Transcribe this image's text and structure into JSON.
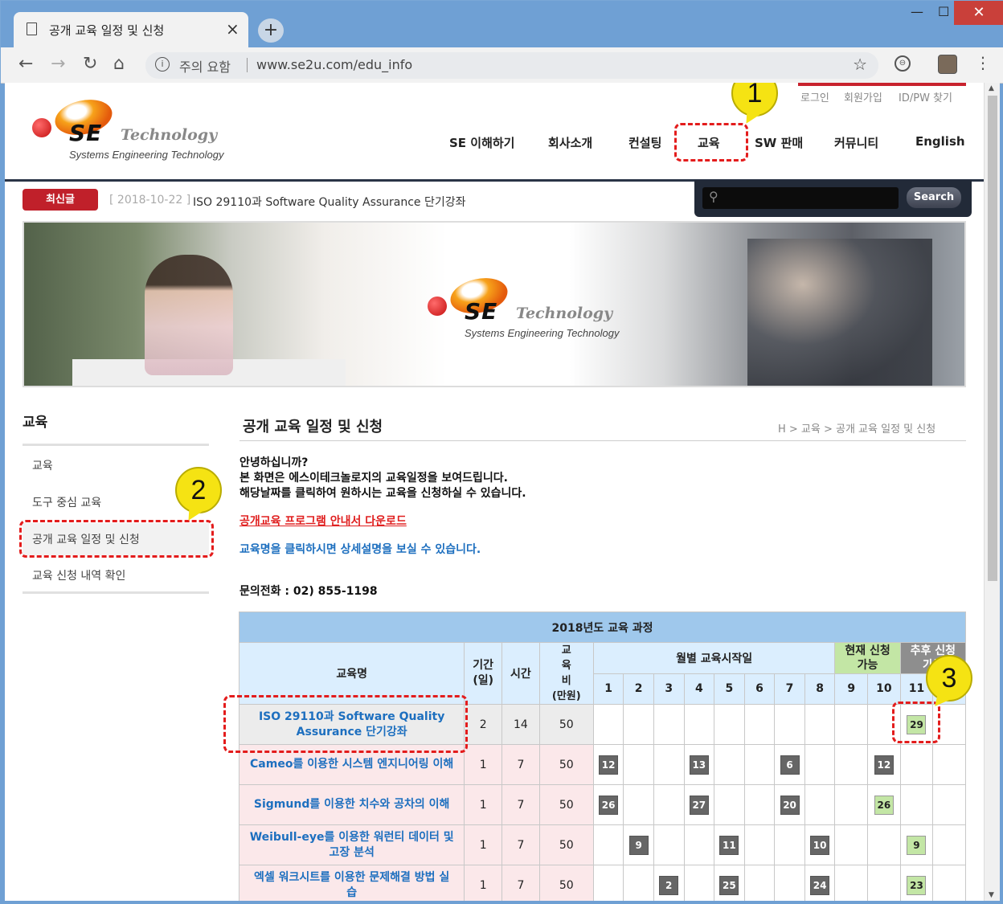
{
  "browser": {
    "tab_title": "공개 교육 일정 및 신청",
    "tab_close": "×",
    "new_tab": "+",
    "minimize": "—",
    "maximize": "☐",
    "close": "✕",
    "security_label": "주의 요함",
    "url": "www.se2u.com/edu_info",
    "icons": [
      "back-icon",
      "forward-icon",
      "reload-icon",
      "home-icon",
      "info-icon",
      "star-icon",
      "extension-icon",
      "profile-icon",
      "menu-icon"
    ]
  },
  "site": {
    "util_links": [
      "로그인",
      "회원가입",
      "ID/PW 찾기"
    ],
    "logo": {
      "main": "SE",
      "tech": "Technology",
      "sub": "Systems Engineering Technology"
    },
    "gnb": [
      "SE 이해하기",
      "회사소개",
      "컨설팅",
      "교육",
      "SW 판매",
      "커뮤니티",
      "English"
    ],
    "news": {
      "badge": "최신글",
      "date": "[ 2018-10-22 ]",
      "text": "ISO 29110과 Software Quality Assurance 단기강좌"
    },
    "search": {
      "button": "Search",
      "placeholder": ""
    },
    "accent_color": "#c0202a",
    "nav_line_color": "#2a3446"
  },
  "lnb": {
    "title": "교육",
    "items": [
      "교육",
      "도구 중심 교육",
      "공개 교육 일정 및 신청",
      "교육 신청 내역 확인"
    ],
    "active_index": 2
  },
  "content": {
    "title": "공개 교육 일정 및 신청",
    "breadcrumb": "H > 교육 > 공개 교육 일정 및 신청",
    "intro": [
      "안녕하십니까?",
      "본 화면은 에스이테크놀로지의 교육일정을 보여드립니다.",
      "해당날짜를 클릭하여 원하시는 교육을 신청하실 수 있습니다."
    ],
    "download_link": "공개교육 프로그램 안내서 다운로드",
    "hint": "교육명을 클릭하시면 상세설명을 보실 수 있습니다.",
    "phone": "문의전화 : 02) 855-1198"
  },
  "table": {
    "caption": "2018년도 교육 과정",
    "headers": {
      "name": "교육명",
      "days": "기간(일)",
      "days_l1": "기간",
      "days_l2": "(일)",
      "hours": "시간",
      "fee_l1": "교",
      "fee_l2": "육",
      "fee_l3": "비",
      "fee_l4": "(만원)",
      "monthly": "월별 교육시작일",
      "now_l1": "현재 신청",
      "now_l2": "가능",
      "next_l1": "추후 신청",
      "next_l2": "가능"
    },
    "months": [
      "1",
      "2",
      "3",
      "4",
      "5",
      "6",
      "7",
      "8",
      "9",
      "10",
      "11",
      "12"
    ],
    "rows": [
      {
        "name_l1": "ISO 29110과 Software Quality",
        "name_l2": "Assurance 단기강좌",
        "days": "2",
        "hours": "14",
        "fee": "50",
        "marks": [
          "",
          "",
          "",
          "",
          "",
          "",
          "",
          "",
          "",
          "",
          "29",
          ""
        ]
      },
      {
        "name_l1": "Cameo를 이용한 시스템 엔지니어링 이해",
        "name_l2": "",
        "days": "1",
        "hours": "7",
        "fee": "50",
        "marks": [
          "12",
          "",
          "",
          "13",
          "",
          "",
          "6",
          "",
          "",
          "12",
          "",
          ""
        ]
      },
      {
        "name_l1": "Sigmund를 이용한 치수와 공차의 이해",
        "name_l2": "",
        "days": "1",
        "hours": "7",
        "fee": "50",
        "marks": [
          "26",
          "",
          "",
          "27",
          "",
          "",
          "20",
          "",
          "",
          "26",
          "",
          ""
        ]
      },
      {
        "name_l1": "Weibull-eye를 이용한 워런티 데이터 및",
        "name_l2": "고장 분석",
        "days": "1",
        "hours": "7",
        "fee": "50",
        "marks": [
          "",
          "9",
          "",
          "",
          "11",
          "",
          "",
          "10",
          "",
          "",
          "9",
          ""
        ]
      },
      {
        "name_l1": "엑셀 워크시트를 이용한 문제해결 방법 실",
        "name_l2": "습",
        "days": "1",
        "hours": "7",
        "fee": "50",
        "marks": [
          "",
          "",
          "2",
          "",
          "25",
          "",
          "",
          "24",
          "",
          "",
          "23",
          ""
        ]
      }
    ]
  },
  "annotations": {
    "c1": "1",
    "c2": "2",
    "c3": "3"
  }
}
